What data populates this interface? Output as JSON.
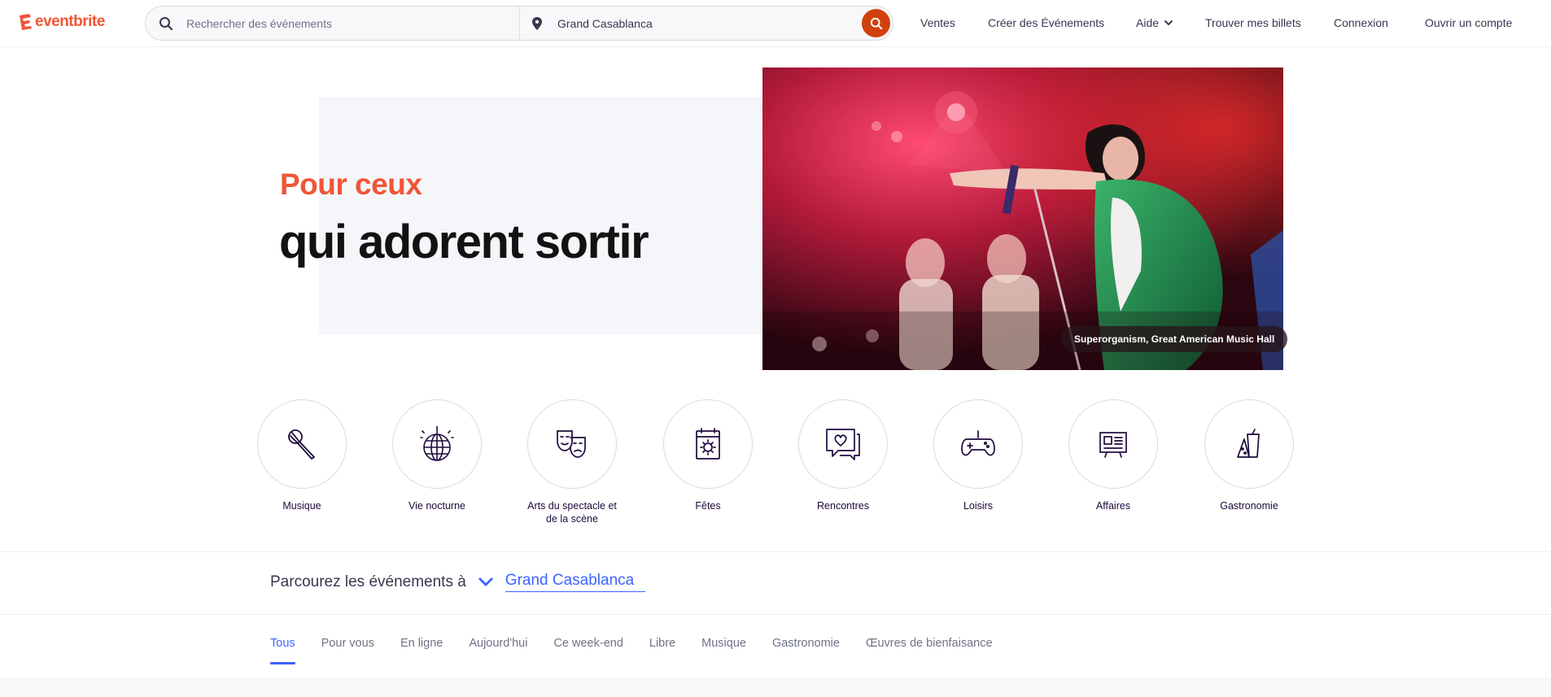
{
  "header": {
    "logo_text": "eventbrite",
    "search": {
      "placeholder": "Rechercher des événements",
      "location_value": "Grand Casablanca"
    },
    "nav": {
      "sell": "Ventes",
      "create": "Créer des Événements",
      "help": "Aide",
      "tickets": "Trouver mes billets",
      "login": "Connexion",
      "signup": "Ouvrir un compte"
    }
  },
  "hero": {
    "subtitle": "Pour ceux",
    "title": "qui adorent sortir",
    "caption": "Superorganism, Great American Music Hall"
  },
  "categories": [
    {
      "label": "Musique",
      "icon": "microphone-icon"
    },
    {
      "label": "Vie nocturne",
      "icon": "disco-ball-icon"
    },
    {
      "label": "Arts du spectacle et de la scène",
      "icon": "theater-masks-icon"
    },
    {
      "label": "Fêtes",
      "icon": "calendar-sun-icon"
    },
    {
      "label": "Rencontres",
      "icon": "chat-heart-icon"
    },
    {
      "label": "Loisirs",
      "icon": "gamepad-icon"
    },
    {
      "label": "Affaires",
      "icon": "presentation-board-icon"
    },
    {
      "label": "Gastronomie",
      "icon": "food-drink-icon"
    }
  ],
  "browse": {
    "label": "Parcourez les événements à",
    "location": "Grand Casablanca"
  },
  "tabs": [
    {
      "label": "Tous",
      "active": true
    },
    {
      "label": "Pour vous"
    },
    {
      "label": "En ligne"
    },
    {
      "label": "Aujourd'hui"
    },
    {
      "label": "Ce week-end"
    },
    {
      "label": "Libre"
    },
    {
      "label": "Musique"
    },
    {
      "label": "Gastronomie"
    },
    {
      "label": "Œuvres de bienfaisance"
    }
  ],
  "colors": {
    "brand": "#f05537",
    "accent": "#3d64ff",
    "search_button": "#d1410c"
  }
}
